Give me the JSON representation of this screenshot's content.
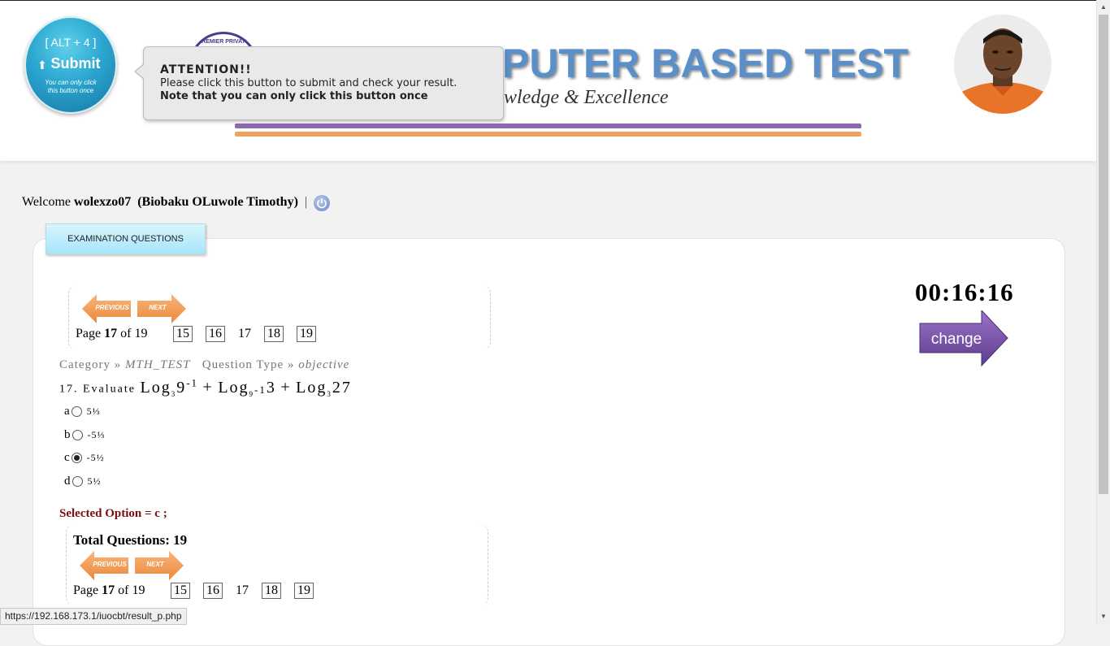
{
  "submit": {
    "shortcut": "[ ALT + 4 ]",
    "label": "Submit",
    "note": "You can only click this button once"
  },
  "banner": {
    "title": "PUTER BASED TEST",
    "motto": "wledge & Excellence",
    "logo_text": "PREMIER PRIVATE"
  },
  "tooltip": {
    "title": "ATTENTION!!",
    "body": "Please click this button to submit and check your result. ",
    "body_bold": "Note that you can only click this button once"
  },
  "user": {
    "welcome_prefix": "Welcome",
    "username": "wolexzo07",
    "fullname": "(Biobaku OLuwole Timothy)",
    "separator": "|"
  },
  "tab": {
    "label": "EXAMINATION QUESTIONS"
  },
  "pager": {
    "previous_label": "PREVIOUS",
    "next_label": "NEXT",
    "page_prefix": "Page",
    "current_page": "17",
    "of_text": "of 19",
    "pages": [
      "15",
      "16",
      "17",
      "18",
      "19"
    ]
  },
  "question": {
    "category_prefix": "Category »",
    "category": "MTH_TEST",
    "type_prefix": "Question Type »",
    "type": "objective",
    "number_prefix": "17. Evaluate",
    "expr_1": "Log",
    "expr_1_base": "3",
    "expr_1_arg": "9",
    "expr_1_exp": "-1",
    "plus": "+",
    "expr_2": "Log",
    "expr_2_base": "9",
    "expr_2_base_exp": "-1",
    "expr_2_arg": "3",
    "expr_3": "Log",
    "expr_3_base": "3",
    "expr_3_arg": "27"
  },
  "options": [
    {
      "letter": "a",
      "text": "5⅓",
      "selected": false
    },
    {
      "letter": "b",
      "text": "-5⅓",
      "selected": false
    },
    {
      "letter": "c",
      "text": "-5½",
      "selected": true
    },
    {
      "letter": "d",
      "text": "5½",
      "selected": false
    }
  ],
  "selected_text": "Selected Option = c ;",
  "total_text": "Total Questions: 19",
  "timer": "00:16:16",
  "change_label": "change",
  "status_url": "https://192.168.173.1/iuocbt/result_p.php",
  "colors": {
    "accent_purple": "#8a6ab0",
    "accent_orange": "#f0a15c",
    "title_blue": "#5b8fc9",
    "selected_red": "#7a0d0d"
  }
}
